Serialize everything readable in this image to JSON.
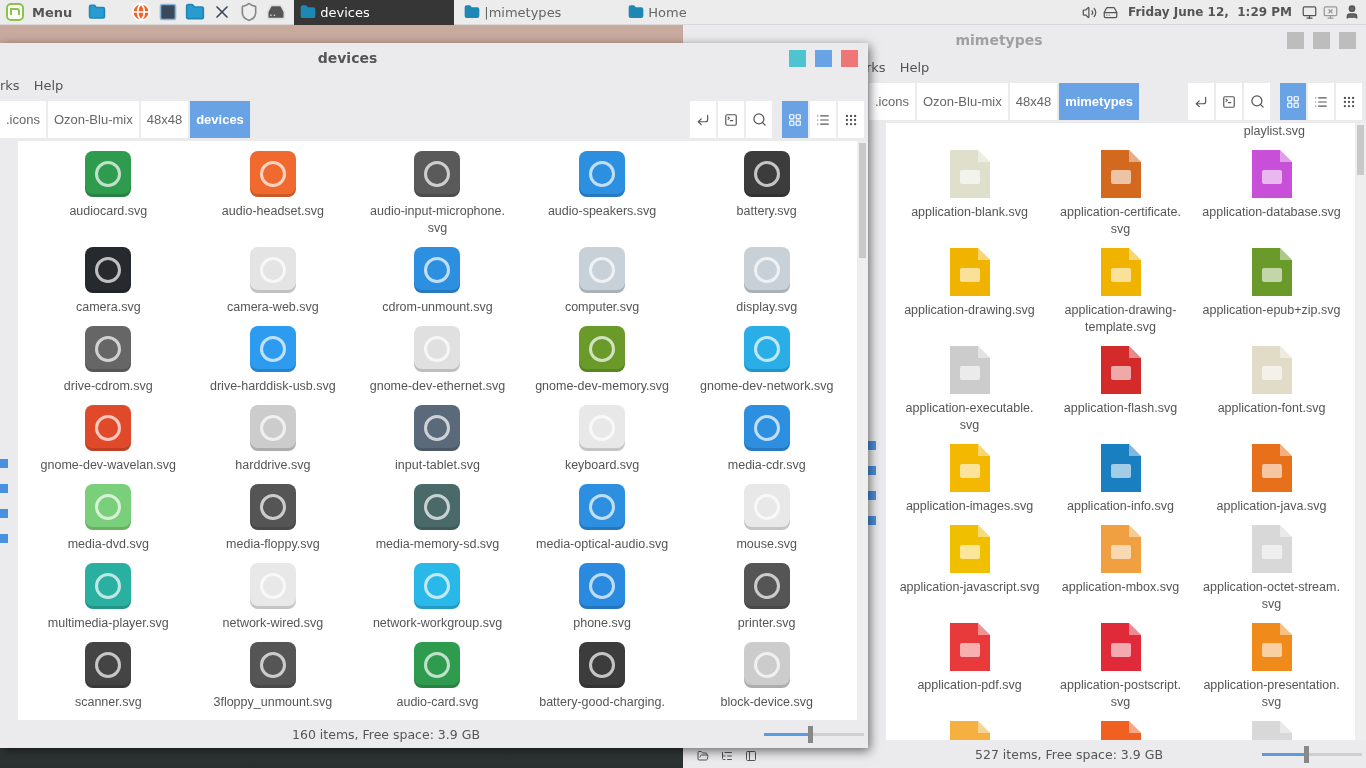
{
  "panel": {
    "menu_label": "Menu",
    "tasks": [
      {
        "label": "devices",
        "selected": true
      },
      {
        "label": "|mimetypes",
        "selected": false
      },
      {
        "label": "Home",
        "selected": false
      }
    ],
    "clock": "Friday June 12,  1:29 PM"
  },
  "windows": [
    {
      "title": "devices",
      "active": true,
      "menu": [
        "rks",
        "Help"
      ],
      "path": [
        {
          "label": ".icons",
          "selected": false
        },
        {
          "label": "Ozon-Blu-mix",
          "selected": false
        },
        {
          "label": "48x48",
          "selected": false
        },
        {
          "label": "devices",
          "selected": true
        }
      ],
      "views": [
        {
          "kind": "icons",
          "selected": true
        },
        {
          "kind": "list",
          "selected": false
        },
        {
          "kind": "compact",
          "selected": false
        }
      ],
      "items": [
        {
          "label": "audiocard.svg",
          "color": "#2e9b4e"
        },
        {
          "label": "audio-headset.svg",
          "color": "#f06a30"
        },
        {
          "label": "audio-input-microphone.svg",
          "color": "#5a5a5a"
        },
        {
          "label": "audio-speakers.svg",
          "color": "#2d8fe0"
        },
        {
          "label": "battery.svg",
          "color": "#3c3c3c"
        },
        {
          "label": "camera.svg",
          "color": "#262a2e"
        },
        {
          "label": "camera-web.svg",
          "color": "#e4e4e4"
        },
        {
          "label": "cdrom-unmount.svg",
          "color": "#2d8fe0"
        },
        {
          "label": "computer.svg",
          "color": "#c8d0d8"
        },
        {
          "label": "display.svg",
          "color": "#c8d0d8"
        },
        {
          "label": "drive-cdrom.svg",
          "color": "#666666"
        },
        {
          "label": "drive-harddisk-usb.svg",
          "color": "#2d9cf0"
        },
        {
          "label": "gnome-dev-ethernet.svg",
          "color": "#e0e0e0"
        },
        {
          "label": "gnome-dev-memory.svg",
          "color": "#6a9a2a"
        },
        {
          "label": "gnome-dev-network.svg",
          "color": "#2aaee8"
        },
        {
          "label": "gnome-dev-wavelan.svg",
          "color": "#e04a2a"
        },
        {
          "label": "harddrive.svg",
          "color": "#cccccc"
        },
        {
          "label": "input-tablet.svg",
          "color": "#5a6a7a"
        },
        {
          "label": "keyboard.svg",
          "color": "#e8e8e8"
        },
        {
          "label": "media-cdr.svg",
          "color": "#2d8fe0"
        },
        {
          "label": "media-dvd.svg",
          "color": "#7ad07a"
        },
        {
          "label": "media-floppy.svg",
          "color": "#555555"
        },
        {
          "label": "media-memory-sd.svg",
          "color": "#4a6a6a"
        },
        {
          "label": "media-optical-audio.svg",
          "color": "#2d8fe0"
        },
        {
          "label": "mouse.svg",
          "color": "#e8e8e8"
        },
        {
          "label": "multimedia-player.svg",
          "color": "#2ab0a0"
        },
        {
          "label": "network-wired.svg",
          "color": "#e8e8e8"
        },
        {
          "label": "network-workgroup.svg",
          "color": "#2ab8e8"
        },
        {
          "label": "phone.svg",
          "color": "#2a8ae0"
        },
        {
          "label": "printer.svg",
          "color": "#555555"
        },
        {
          "label": "scanner.svg",
          "color": "#444444"
        },
        {
          "label": "3floppy_unmount.svg",
          "color": "#555555"
        },
        {
          "label": "audio-card.svg",
          "color": "#2e9b4e"
        },
        {
          "label": "battery-good-charging.",
          "color": "#3c3c3c"
        },
        {
          "label": "block-device.svg",
          "color": "#cccccc"
        }
      ],
      "status": "160 items, Free space: 3.9 GB",
      "zoom": {
        "level": 0.47
      }
    },
    {
      "title": "mimetypes",
      "active": false,
      "menu": [
        "rks",
        "Help"
      ],
      "path": [
        {
          "label": ".icons",
          "selected": false
        },
        {
          "label": "Ozon-Blu-mix",
          "selected": false
        },
        {
          "label": "48x48",
          "selected": false
        },
        {
          "label": "mimetypes",
          "selected": true
        }
      ],
      "views": [
        {
          "kind": "icons",
          "selected": true
        },
        {
          "kind": "list",
          "selected": false
        },
        {
          "kind": "compact",
          "selected": false
        }
      ],
      "partial_label": "playlist.svg",
      "items": [
        {
          "label": "application-blank.svg",
          "color": "#dfe0cc"
        },
        {
          "label": "application-certificate.svg",
          "color": "#d2691e"
        },
        {
          "label": "application-database.svg",
          "color": "#c84fd8"
        },
        {
          "label": "application-drawing.svg",
          "color": "#f0b400"
        },
        {
          "label": "application-drawing-template.svg",
          "color": "#f0b400"
        },
        {
          "label": "application-epub+zip.svg",
          "color": "#6a9a2a"
        },
        {
          "label": "application-executable.svg",
          "color": "#cccccc"
        },
        {
          "label": "application-flash.svg",
          "color": "#d42a2a"
        },
        {
          "label": "application-font.svg",
          "color": "#e0dcc8"
        },
        {
          "label": "application-images.svg",
          "color": "#f5b800"
        },
        {
          "label": "application-info.svg",
          "color": "#1a7fc0"
        },
        {
          "label": "application-java.svg",
          "color": "#e8701a"
        },
        {
          "label": "application-javascript.svg",
          "color": "#f0c000"
        },
        {
          "label": "application-mbox.svg",
          "color": "#f0a040"
        },
        {
          "label": "application-octet-stream.svg",
          "color": "#d8d8d8"
        },
        {
          "label": "application-pdf.svg",
          "color": "#e83a3a"
        },
        {
          "label": "application-postscript.svg",
          "color": "#e02a3a"
        },
        {
          "label": "application-presentation.svg",
          "color": "#f08a1a"
        },
        {
          "color": "#f5b040"
        },
        {
          "color": "#f06020"
        },
        {
          "color": "#d8d8d8"
        }
      ],
      "status": "527 items, Free space: 3.9 GB",
      "zoom": {
        "level": 0.45
      }
    }
  ]
}
